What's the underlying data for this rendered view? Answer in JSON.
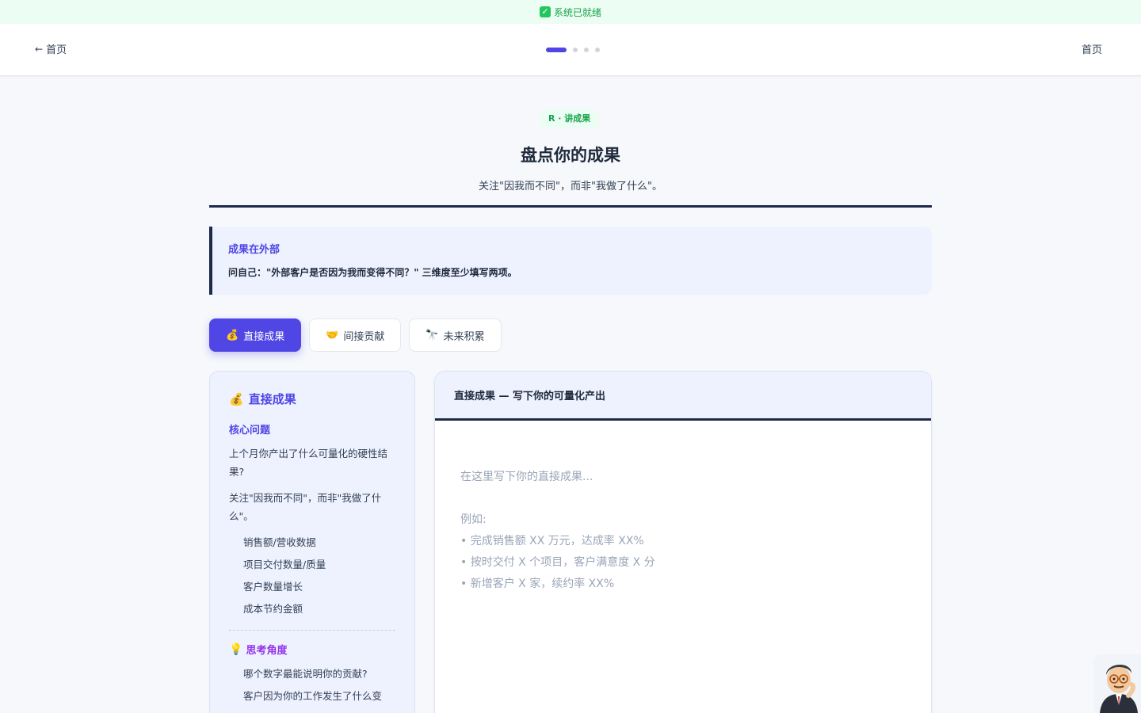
{
  "status": {
    "text": "系统已就绪"
  },
  "nav": {
    "back_label": "首页",
    "home_label": "首页",
    "progress_steps": 4,
    "current_step": 1
  },
  "page": {
    "tag": "R · 讲成果",
    "title": "盘点你的成果",
    "subtitle": "关注\"因我而不同\"，而非\"我做了什么\"。"
  },
  "callout": {
    "title": "成果在外部",
    "text": "问自己：\"外部客户是否因为我而变得不同？\" 三维度至少填写两项。"
  },
  "tabs": [
    {
      "emoji": "💰",
      "label": "直接成果",
      "active": true
    },
    {
      "emoji": "🤝",
      "label": "间接贡献",
      "active": false
    },
    {
      "emoji": "🔭",
      "label": "未来积累",
      "active": false
    }
  ],
  "left_panel": {
    "heading_emoji": "💰",
    "heading": "直接成果",
    "core_title": "核心问题",
    "p1": "上个月你产出了什么可量化的硬性结果?",
    "p2": "关注\"因我而不同\"，而非\"我做了什么\"。",
    "examples": [
      "销售额/营收数据",
      "项目交付数量/质量",
      "客户数量增长",
      "成本节约金额"
    ],
    "think_emoji": "💡",
    "think_title": "思考角度",
    "think_items": [
      "哪个数字最能说明你的贡献?",
      "客户因为你的工作发生了什么变化?"
    ]
  },
  "editor": {
    "header": "直接成果 — 写下你的可量化产出",
    "placeholder": "在这里写下你的直接成果...\n\n例如:\n• 完成销售额 XX 万元，达成率 XX%\n• 按时交付 X 个项目，客户满意度 X 分\n• 新增客户 X 家，续约率 XX%",
    "value": ""
  },
  "colors": {
    "accent": "#4f46e5",
    "success": "#16a34a",
    "navy": "#1e2a4a"
  }
}
